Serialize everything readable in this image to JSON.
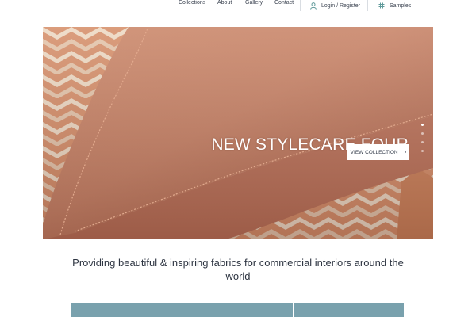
{
  "nav": {
    "links": [
      "Collections",
      "About",
      "Gallery",
      "Contact"
    ],
    "login_label": "Login / Register",
    "samples_label": "Samples",
    "icons": [
      "user-icon",
      "grid-icon"
    ]
  },
  "hero": {
    "title": "NEW STYLECARE FOUR",
    "button_label": "VIEW COLLECTION",
    "slide_count": 4,
    "active_slide": 1
  },
  "tagline": "Providing beautiful & inspiring fabrics for commercial interiors around the world",
  "colors": {
    "accent_teal": "#79a1ad",
    "fabric_terracotta": "#c07a60",
    "text_dark": "#2e3542"
  }
}
